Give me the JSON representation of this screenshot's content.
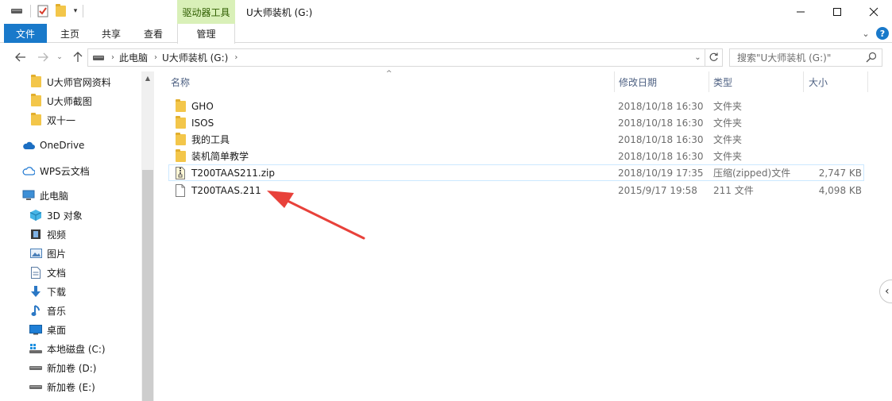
{
  "window": {
    "title": "U大师装机 (G:)",
    "context_tab_group": "驱动器工具"
  },
  "ribbon": {
    "tabs": [
      "文件",
      "主页",
      "共享",
      "查看",
      "管理"
    ]
  },
  "address": {
    "segments": [
      "此电脑",
      "U大师装机 (G:)"
    ]
  },
  "search": {
    "placeholder": "搜索\"U大师装机 (G:)\""
  },
  "nav": {
    "items": [
      {
        "label": "U大师官网资料",
        "icon": "folder-icon"
      },
      {
        "label": "U大师截图",
        "icon": "folder-icon"
      },
      {
        "label": "双十一",
        "icon": "folder-icon"
      },
      {
        "label": "OneDrive",
        "icon": "cloud-icon"
      },
      {
        "label": "WPS云文档",
        "icon": "wps-cloud-icon"
      },
      {
        "label": "此电脑",
        "icon": "computer-icon"
      },
      {
        "label": "3D 对象",
        "icon": "cube-icon"
      },
      {
        "label": "视频",
        "icon": "video-icon"
      },
      {
        "label": "图片",
        "icon": "picture-icon"
      },
      {
        "label": "文档",
        "icon": "document-icon"
      },
      {
        "label": "下载",
        "icon": "download-icon"
      },
      {
        "label": "音乐",
        "icon": "music-icon"
      },
      {
        "label": "桌面",
        "icon": "desktop-icon"
      },
      {
        "label": "本地磁盘 (C:)",
        "icon": "windows-drive-icon"
      },
      {
        "label": "新加卷 (D:)",
        "icon": "drive-icon"
      },
      {
        "label": "新加卷 (E:)",
        "icon": "drive-icon"
      }
    ]
  },
  "columns": {
    "name": "名称",
    "modified": "修改日期",
    "type": "类型",
    "size": "大小"
  },
  "files": [
    {
      "name": "GHO",
      "modified": "2018/10/18 16:30",
      "type": "文件夹",
      "size": "",
      "icon": "folder-icon"
    },
    {
      "name": "ISOS",
      "modified": "2018/10/18 16:30",
      "type": "文件夹",
      "size": "",
      "icon": "folder-icon"
    },
    {
      "name": "我的工具",
      "modified": "2018/10/18 16:30",
      "type": "文件夹",
      "size": "",
      "icon": "folder-icon"
    },
    {
      "name": "装机简单教学",
      "modified": "2018/10/18 16:30",
      "type": "文件夹",
      "size": "",
      "icon": "folder-icon"
    },
    {
      "name": "T200TAAS211.zip",
      "modified": "2018/10/19 17:35",
      "type": "压缩(zipped)文件",
      "size": "2,747 KB",
      "icon": "zip-folder-icon"
    },
    {
      "name": "T200TAAS.211",
      "modified": "2015/9/17 19:58",
      "type": "211 文件",
      "size": "4,098 KB",
      "icon": "file-icon"
    }
  ],
  "colors": {
    "file_tab": "#1979ca",
    "context_tab": "#d9f0b8",
    "folder": "#f3c64a",
    "annotation_arrow": "#e8413a",
    "selection": "#cce8ff"
  }
}
